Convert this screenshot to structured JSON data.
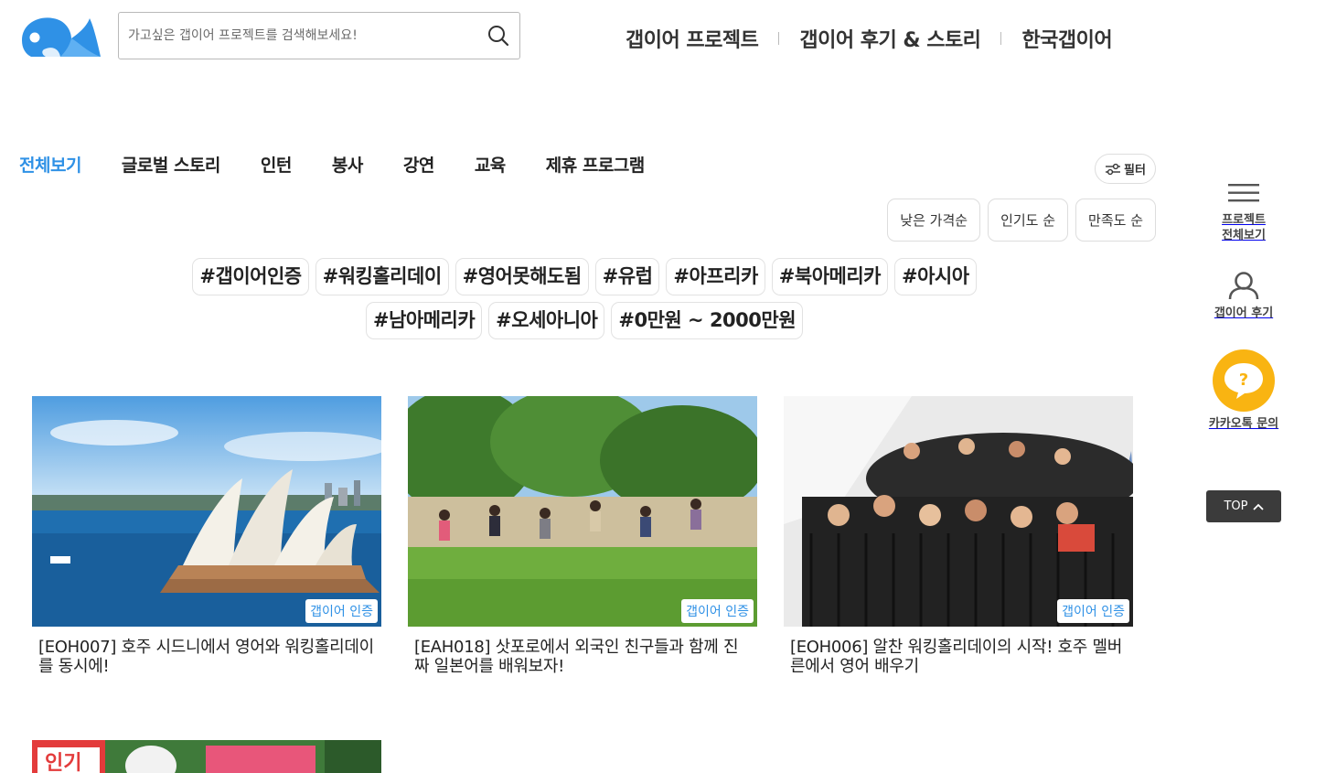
{
  "brand": {
    "logo_icon": "whale-logo-icon",
    "accent": "#2f91e6"
  },
  "search": {
    "placeholder": "가고싶은 갭이어 프로젝트를 검색해보세요!",
    "value": ""
  },
  "topnav": [
    "갭이어 프로젝트",
    "갭이어 후기 & 스토리",
    "한국갭이어"
  ],
  "categories": {
    "active": "전체보기",
    "items": [
      "전체보기",
      "글로벌 스토리",
      "인턴",
      "봉사",
      "강연",
      "교육",
      "제휴 프로그램"
    ]
  },
  "filter": {
    "label": "필터",
    "icon": "sliders-icon"
  },
  "sorts": [
    "낮은 가격순",
    "인기도 순",
    "만족도 순"
  ],
  "tags": [
    "#갭이어인증",
    "#워킹홀리데이",
    "#영어못해도됨",
    "#유럽",
    "#아프리카",
    "#북아메리카",
    "#아시아",
    "#남아메리카",
    "#오세아니아",
    "#0만원 ~ 2000만원"
  ],
  "cards": [
    {
      "badge": "갭이어 인증",
      "title": "[EOH007] 호주 시드니에서 영어와 워킹홀리데이를 동시에!"
    },
    {
      "badge": "갭이어 인증",
      "title": "[EAH018] 삿포로에서 외국인 친구들과 함께 진짜 일본어를 배워보자!"
    },
    {
      "badge": "갭이어 인증",
      "title": "[EOH006] 알찬 워킹홀리데이의 시작! 호주 멜버른에서 영어 배우기"
    },
    {
      "badge_text": "인기"
    }
  ],
  "side": {
    "menu_label": "프로젝트 전체보기",
    "review_label": "갭이어 후기",
    "kakao_label": "카카오톡 문의",
    "top_label": "TOP",
    "kakao_color": "#f9b412"
  }
}
